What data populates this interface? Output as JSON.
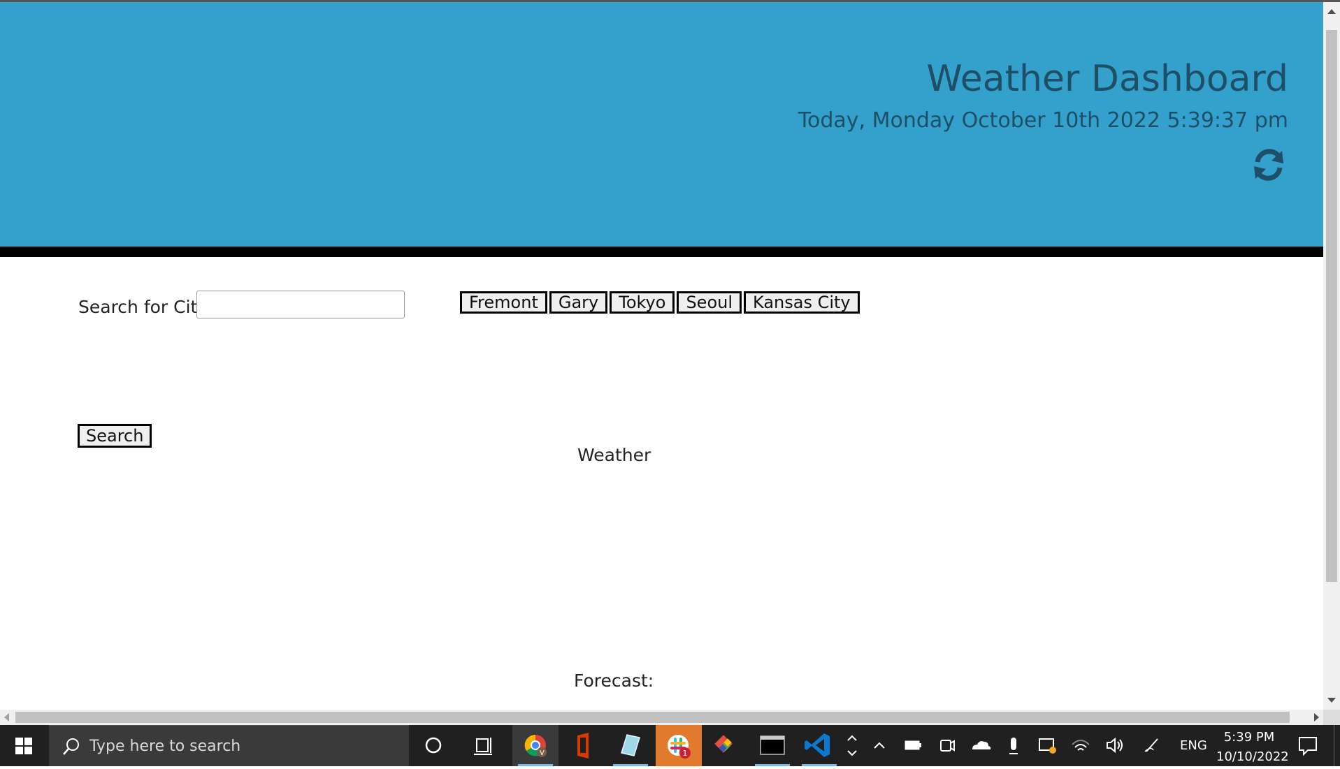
{
  "header": {
    "title": "Weather Dashboard",
    "date": "Today, Monday October 10th 2022 5:39:37 pm",
    "refresh_icon": "refresh-icon"
  },
  "search": {
    "label": "Search for City",
    "value": "",
    "placeholder": "",
    "button_label": "Search"
  },
  "cities": [
    "Fremont",
    "Gary",
    "Tokyo",
    "Seoul",
    "Kansas City"
  ],
  "main": {
    "weather_label": "Weather",
    "forecast_label": "Forecast:"
  },
  "taskbar": {
    "search_placeholder": "Type here to search",
    "apps": [
      "cortana-icon",
      "task-view-icon",
      "chrome-icon",
      "office-icon",
      "notes-icon",
      "slack-icon",
      "git-icon",
      "terminal-icon",
      "vscode-icon"
    ],
    "slack_badge": "1",
    "language": "ENG",
    "time": "5:39 PM",
    "date": "10/10/2022"
  },
  "colors": {
    "header_bg": "#33a1cc",
    "header_text": "#1f4f66",
    "taskbar_bg": "#202020"
  }
}
